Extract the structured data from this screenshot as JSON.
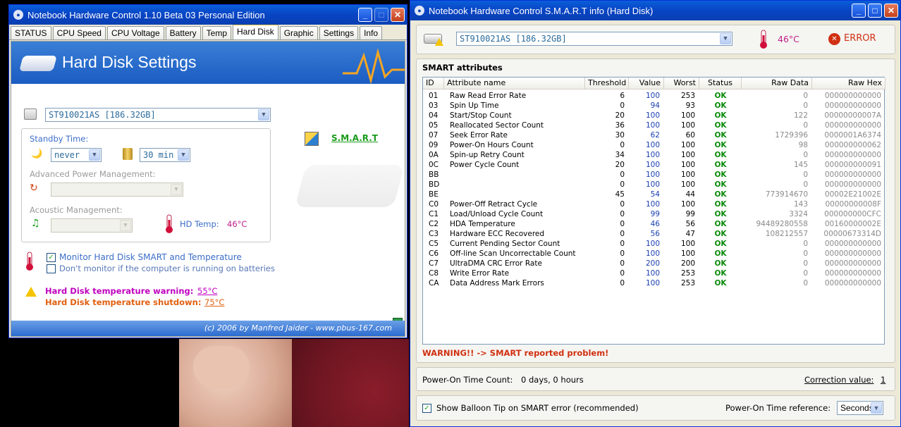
{
  "left_window": {
    "title": "Notebook Hardware Control 1.10 Beta 03   Personal Edition",
    "tabs": [
      "STATUS",
      "CPU Speed",
      "CPU Voltage",
      "Battery",
      "Temp",
      "Hard Disk",
      "Graphic",
      "Settings",
      "Info"
    ],
    "active_tab": "Hard Disk",
    "banner_title": "Hard Disk Settings",
    "disk_select": "ST910021AS [186.32GB]",
    "standby_label": "Standby Time:",
    "standby_value1": "never",
    "standby_value2": "30 min",
    "apm_label": "Advanced Power Management:",
    "acoustic_label": "Acoustic Management:",
    "smart_link": "S.M.A.R.T",
    "hd_temp_label": "HD Temp:",
    "hd_temp_value": "46°C",
    "monitor_label": "Monitor Hard Disk SMART and Temperature",
    "no_battery_label": "Don't monitor if the computer is running on batteries",
    "temp_warning_label": "Hard Disk temperature warning:",
    "temp_warning_value": "55°C",
    "temp_shutdown_label": "Hard Disk temperature shutdown:",
    "temp_shutdown_value": "75°C",
    "footer": "(c) 2006 by Manfred Jaider  -  www.pbus-167.com"
  },
  "right_window": {
    "title": "Notebook Hardware Control  S.M.A.R.T  info (Hard Disk)",
    "disk_select": "ST910021AS [186.32GB]",
    "temp": "46°C",
    "status": "ERROR",
    "smart_heading": "SMART attributes",
    "columns": [
      "ID",
      "Attribute name",
      "Threshold",
      "Value",
      "Worst",
      "Status",
      "Raw Data",
      "Raw Hex"
    ],
    "rows": [
      [
        "01",
        "Raw Read Error Rate",
        "6",
        "100",
        "253",
        "OK",
        "0",
        "000000000000"
      ],
      [
        "03",
        "Spin Up Time",
        "0",
        "94",
        "93",
        "OK",
        "0",
        "000000000000"
      ],
      [
        "04",
        "Start/Stop Count",
        "20",
        "100",
        "100",
        "OK",
        "122",
        "00000000007A"
      ],
      [
        "05",
        "Reallocated Sector Count",
        "36",
        "100",
        "100",
        "OK",
        "0",
        "000000000000"
      ],
      [
        "07",
        "Seek Error Rate",
        "30",
        "62",
        "60",
        "OK",
        "1729396",
        "0000001A6374"
      ],
      [
        "09",
        "Power-On Hours Count",
        "0",
        "100",
        "100",
        "OK",
        "98",
        "000000000062"
      ],
      [
        "0A",
        "Spin-up Retry Count",
        "34",
        "100",
        "100",
        "OK",
        "0",
        "000000000000"
      ],
      [
        "0C",
        "Power Cycle Count",
        "20",
        "100",
        "100",
        "OK",
        "145",
        "000000000091"
      ],
      [
        "BB",
        "",
        "0",
        "100",
        "100",
        "OK",
        "0",
        "000000000000"
      ],
      [
        "BD",
        "",
        "0",
        "100",
        "100",
        "OK",
        "0",
        "000000000000"
      ],
      [
        "BE",
        "",
        "45",
        "54",
        "44",
        "OK",
        "773914670",
        "00002E21002E"
      ],
      [
        "C0",
        "Power-Off Retract Cycle",
        "0",
        "100",
        "100",
        "OK",
        "143",
        "00000000008F"
      ],
      [
        "C1",
        "Load/Unload Cycle Count",
        "0",
        "99",
        "99",
        "OK",
        "3324",
        "000000000CFC"
      ],
      [
        "C2",
        "HDA Temperature",
        "0",
        "46",
        "56",
        "OK",
        "94489280558",
        "00160000002E"
      ],
      [
        "C3",
        "Hardware ECC Recovered",
        "0",
        "56",
        "47",
        "OK",
        "108212557",
        "00000673314D"
      ],
      [
        "C5",
        "Current Pending Sector Count",
        "0",
        "100",
        "100",
        "OK",
        "0",
        "000000000000"
      ],
      [
        "C6",
        "Off-line Scan Uncorrectable Count",
        "0",
        "100",
        "100",
        "OK",
        "0",
        "000000000000"
      ],
      [
        "C7",
        "UltraDMA CRC Error Rate",
        "0",
        "200",
        "200",
        "OK",
        "0",
        "000000000000"
      ],
      [
        "C8",
        "Write Error Rate",
        "0",
        "100",
        "253",
        "OK",
        "0",
        "000000000000"
      ],
      [
        "CA",
        "Data Address Mark Errors",
        "0",
        "100",
        "253",
        "OK",
        "0",
        "000000000000"
      ]
    ],
    "warning": "WARNING!! -> SMART reported problem!",
    "power_on_label": "Power-On Time Count:",
    "power_on_value": "0 days,  0 hours",
    "correction_label": "Correction value:",
    "correction_value": "1",
    "balloon_label": "Show Balloon Tip on SMART error (recommended)",
    "power_on_ref_label": "Power-On Time reference:",
    "power_on_ref_value": "Seconds"
  },
  "colors": {
    "title_blue": "#0A4FCF",
    "ok_green": "#0A8A0A",
    "error_red": "#D03010",
    "warning_magenta": "#C000C0",
    "shutdown_orange": "#E06010",
    "temp_magenta": "#C0208A"
  }
}
